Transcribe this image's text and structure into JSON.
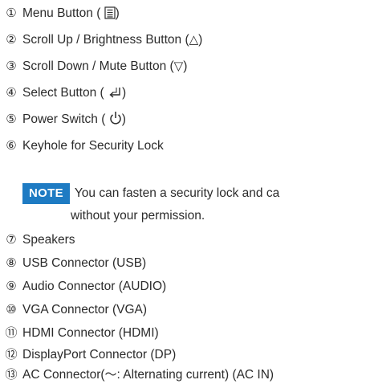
{
  "items": [
    {
      "num": "①",
      "label": "Menu Button (",
      "symbol": "",
      "suffix": ")"
    },
    {
      "num": "②",
      "label": "Scroll Up / Brightness Button (",
      "symbol": "△",
      "suffix": ")"
    },
    {
      "num": "③",
      "label": "Scroll Down / Mute Button (",
      "symbol": "▽",
      "suffix": ")"
    },
    {
      "num": "④",
      "label": "Select Button (",
      "symbol": "",
      "suffix": ")"
    },
    {
      "num": "⑤",
      "label": "Power Switch (",
      "symbol": "",
      "suffix": ")"
    },
    {
      "num": "⑥",
      "label": "Keyhole for Security Lock",
      "symbol": "",
      "suffix": ""
    },
    {
      "num": "⑦",
      "label": "Speakers",
      "symbol": "",
      "suffix": ""
    },
    {
      "num": "⑧",
      "label": "USB Connector (USB)",
      "symbol": "",
      "suffix": ""
    },
    {
      "num": "⑨",
      "label": "Audio Connector (AUDIO)",
      "symbol": "",
      "suffix": ""
    },
    {
      "num": "⑩",
      "label": "VGA Connector (VGA)",
      "symbol": "",
      "suffix": ""
    },
    {
      "num": "⑪",
      "label": "HDMI Connector (HDMI)",
      "symbol": "",
      "suffix": ""
    },
    {
      "num": "⑫",
      "label": "DisplayPort Connector (DP)",
      "symbol": "",
      "suffix": ""
    },
    {
      "num": "⑬",
      "label": "AC Connector(",
      "symbol": "～",
      "suffix": ": Alternating current) (AC IN)"
    }
  ],
  "note": {
    "badge": "NOTE",
    "line1": "You can fasten a security lock and ca",
    "line2": "without your permission."
  },
  "colors": {
    "note_badge_bg": "#1e7bc3",
    "text": "#2b2b2b"
  },
  "icons": {
    "menu": "menu-list-icon",
    "select": "enter-return-icon",
    "power": "power-icon"
  }
}
